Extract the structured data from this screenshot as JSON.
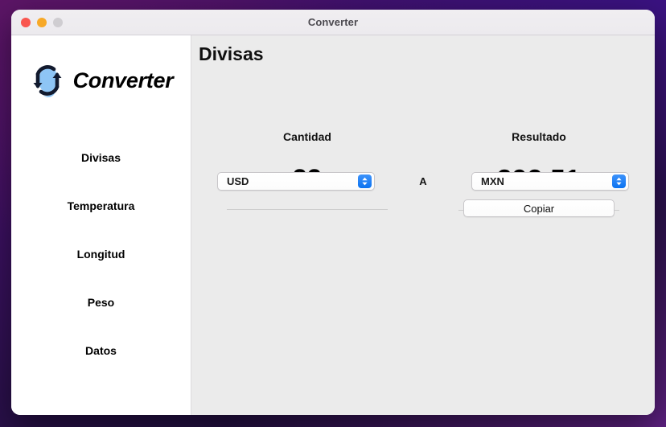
{
  "window": {
    "title": "Converter",
    "traffic_lights": [
      {
        "name": "close",
        "color": "#f9564f"
      },
      {
        "name": "minimize",
        "color": "#f7a928"
      },
      {
        "name": "zoom",
        "color": "#cfcdd1"
      }
    ]
  },
  "sidebar": {
    "logo": {
      "text": "Converter",
      "icon": "circular-arrows-icon",
      "icon_fill": "#8ec5f5",
      "icon_stroke": "#121a2e"
    },
    "items": [
      {
        "label": "Divisas",
        "selected": true
      },
      {
        "label": "Temperatura",
        "selected": false
      },
      {
        "label": "Longitud",
        "selected": false
      },
      {
        "label": "Peso",
        "selected": false
      },
      {
        "label": "Datos",
        "selected": false
      }
    ]
  },
  "content": {
    "page_title": "Divisas",
    "amount": {
      "label": "Cantidad",
      "value": "23"
    },
    "result": {
      "label": "Resultado",
      "value": "392.51"
    },
    "from_currency": {
      "value": "USD",
      "arrows_icon": "chevron-up-down-icon",
      "accent": "#0a72f0"
    },
    "separator_label": "A",
    "to_currency": {
      "value": "MXN",
      "arrows_icon": "chevron-up-down-icon",
      "accent": "#0a72f0"
    },
    "copy_button": {
      "label": "Copiar"
    }
  },
  "theme": {
    "sidebar_bg": "#ffffff",
    "content_bg": "#ebebeb",
    "titlebar_bg": "#eceaee",
    "desktop_gradient_start": "#4a1169",
    "desktop_gradient_end": "#1b0c33"
  }
}
